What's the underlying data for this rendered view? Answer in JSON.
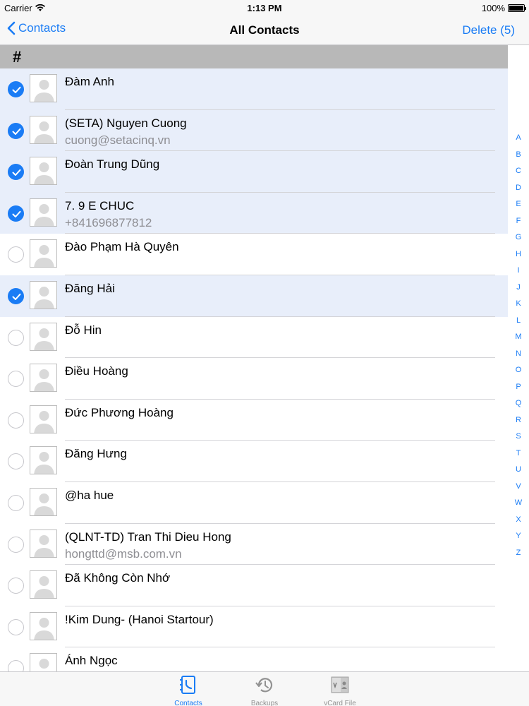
{
  "status": {
    "carrier": "Carrier",
    "time": "1:13 PM",
    "battery": "100%",
    "battery_level": 1.0
  },
  "nav": {
    "back_label": "Contacts",
    "title": "All Contacts",
    "delete_label": "Delete (5)"
  },
  "section": {
    "header": "#"
  },
  "contacts": [
    {
      "name": "Đàm Anh",
      "sub": "",
      "selected": true
    },
    {
      "name": "(SETA) Nguyen Cuong",
      "sub": "cuong@setacinq.vn",
      "selected": true
    },
    {
      "name": "Đoàn Trung Dũng",
      "sub": "",
      "selected": true
    },
    {
      "name": "7. 9 E CHUC",
      "sub": "+841696877812",
      "selected": true
    },
    {
      "name": "Đào Phạm Hà Quyên",
      "sub": "",
      "selected": false
    },
    {
      "name": "Đăng Hải",
      "sub": "",
      "selected": true
    },
    {
      "name": "Đỗ Hin",
      "sub": "",
      "selected": false
    },
    {
      "name": "Điều Hoàng",
      "sub": "",
      "selected": false
    },
    {
      "name": "Đức Phương Hoàng",
      "sub": "",
      "selected": false
    },
    {
      "name": "Đăng Hưng",
      "sub": "",
      "selected": false
    },
    {
      "name": "@ha hue",
      "sub": "",
      "selected": false
    },
    {
      "name": "(QLNT-TD) Tran Thi Dieu Hong",
      "sub": "hongttd@msb.com.vn",
      "selected": false
    },
    {
      "name": "Đã Không Còn Nhớ",
      "sub": "",
      "selected": false
    },
    {
      "name": "!Kim Dung- (Hanoi Startour)",
      "sub": "",
      "selected": false
    },
    {
      "name": "Ánh Ngọc",
      "sub": "",
      "selected": false
    }
  ],
  "index_letters": [
    "A",
    "B",
    "C",
    "D",
    "E",
    "F",
    "G",
    "H",
    "I",
    "J",
    "K",
    "L",
    "M",
    "N",
    "O",
    "P",
    "Q",
    "R",
    "S",
    "T",
    "U",
    "V",
    "W",
    "X",
    "Y",
    "Z"
  ],
  "tabs": [
    {
      "label": "Contacts",
      "icon": "contacts-icon",
      "active": true
    },
    {
      "label": "Backups",
      "icon": "backups-icon",
      "active": false
    },
    {
      "label": "vCard File",
      "icon": "vcard-file-icon",
      "active": false
    }
  ],
  "colors": {
    "accent": "#1a7cf5",
    "selected_row": "#e8eefa",
    "section_header": "#b8b8b8"
  }
}
